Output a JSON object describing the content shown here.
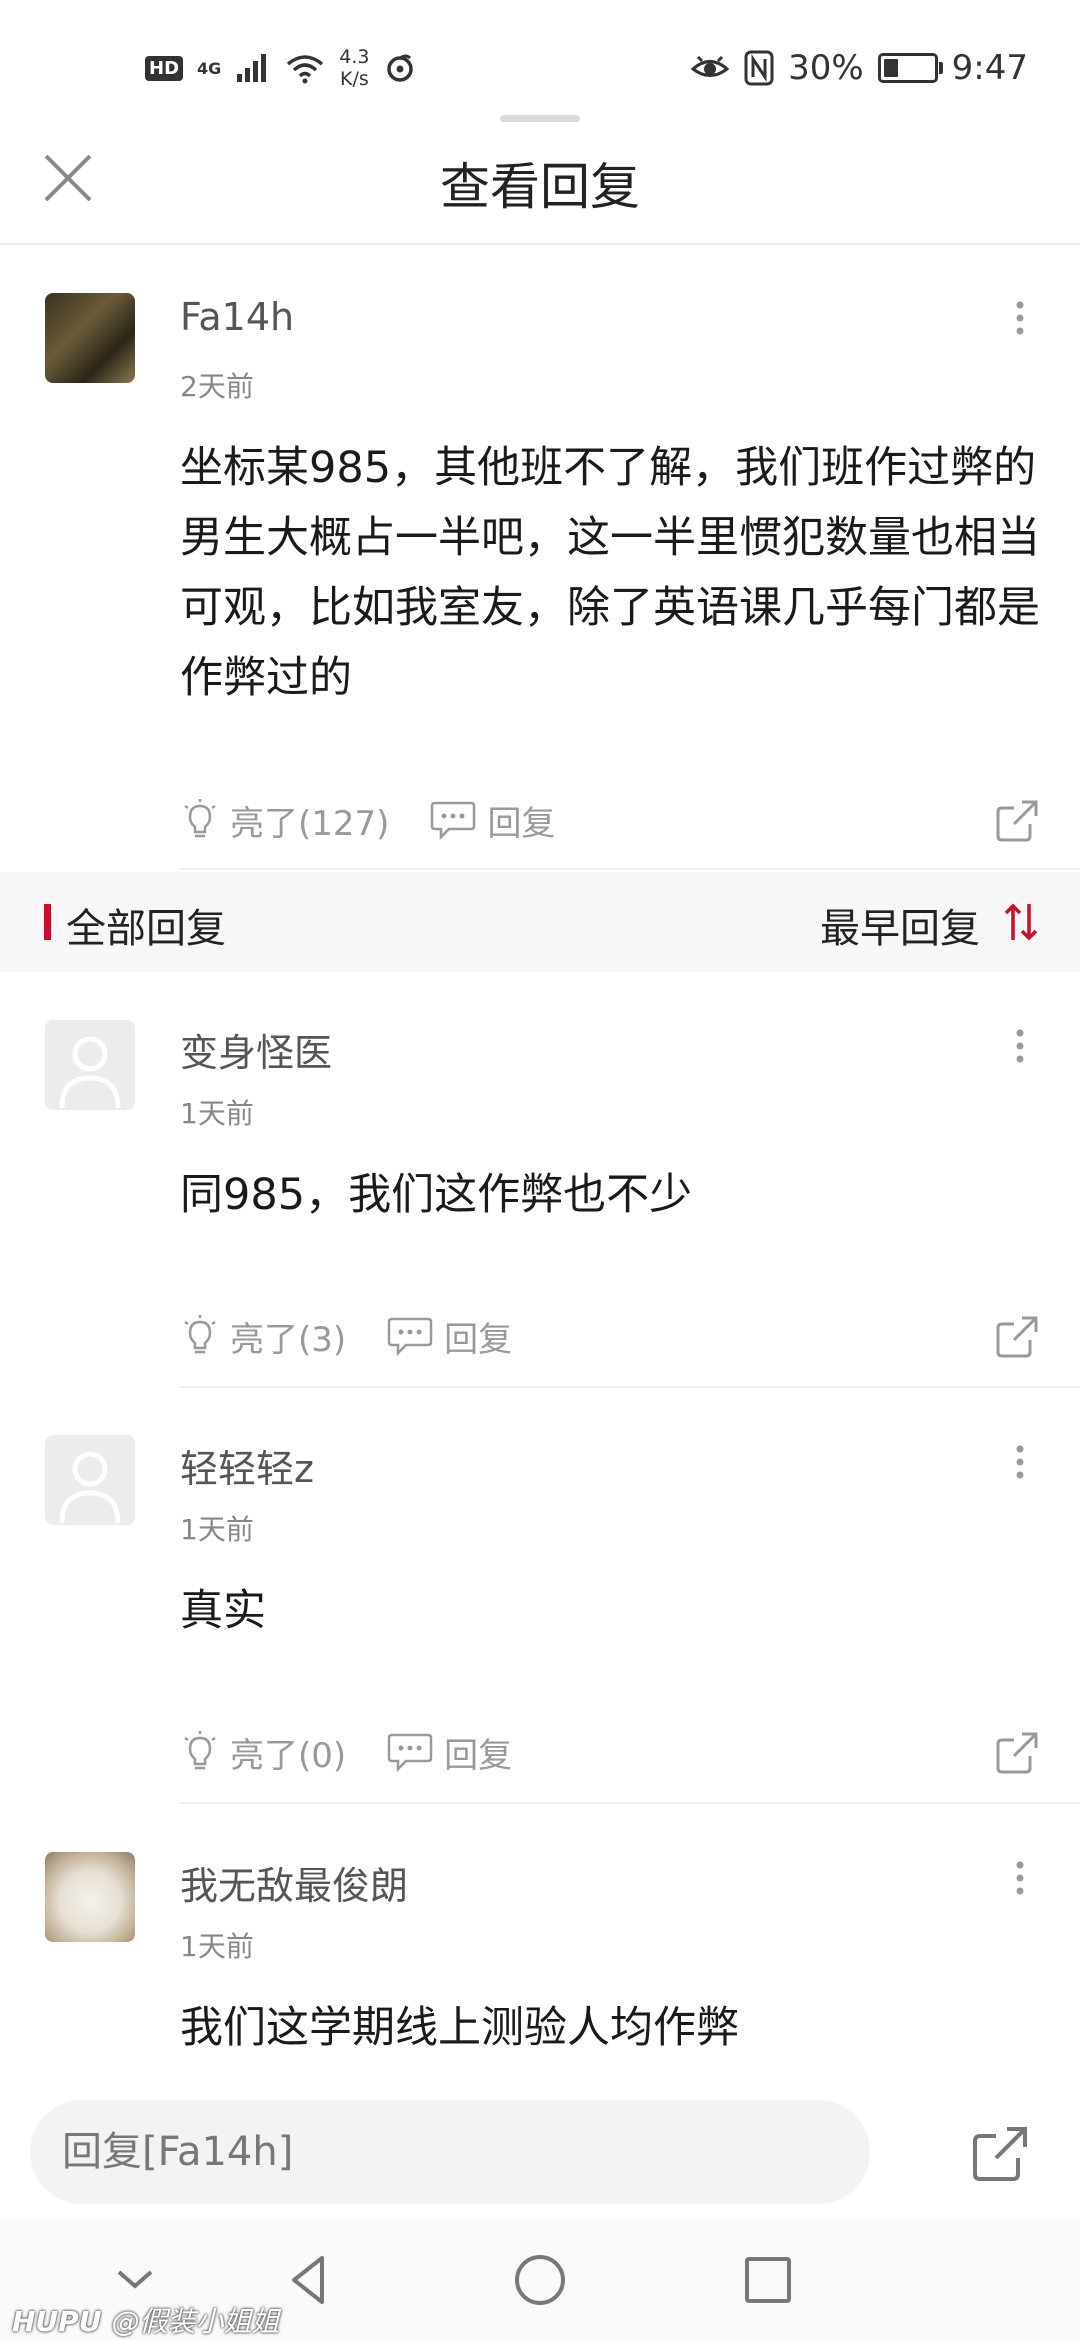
{
  "status_bar": {
    "hd": "HD",
    "network": "4G",
    "speed_top": "4.3",
    "speed_bottom": "K/s",
    "battery_text": "30%",
    "battery_level": 0.3,
    "time": "9:47"
  },
  "header": {
    "title": "查看回复"
  },
  "main_post": {
    "username": "Fa14h",
    "time": "2天前",
    "content": "坐标某985，其他班不了解，我们班作过弊的男生大概占一半吧，这一半里惯犯数量也相当可观，比如我室友，除了英语课几乎每门都是作弊过的",
    "like_label": "亮了(127)",
    "reply_label": "回复"
  },
  "section": {
    "title": "全部回复",
    "sort_label": "最早回复",
    "accent_color": "#c8102e"
  },
  "replies": [
    {
      "username": "变身怪医",
      "time": "1天前",
      "content": "同985，我们这作弊也不少",
      "like_label": "亮了(3)",
      "reply_label": "回复"
    },
    {
      "username": "轻轻轻z",
      "time": "1天前",
      "content": "真实",
      "like_label": "亮了(0)",
      "reply_label": "回复"
    },
    {
      "username": "我无敌最俊朗",
      "time": "1天前",
      "content": "我们这学期线上测验人均作弊"
    }
  ],
  "reply_bar": {
    "placeholder": "回复[Fa14h]"
  },
  "watermark": {
    "brand": "HUPU",
    "handle": "@假装小姐姐"
  }
}
